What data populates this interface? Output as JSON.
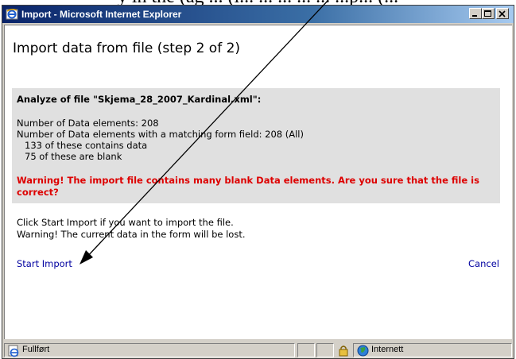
{
  "page_text_above": "y in the (ag ... (i... ... ... ... ... ...p... (...",
  "window": {
    "title": "Import - Microsoft Internet Explorer",
    "minimize_icon": "minimize-icon",
    "maximize_icon": "maximize-icon",
    "close_icon": "close-icon"
  },
  "dialog": {
    "heading": "Import data from file (step 2 of 2)",
    "analyze_title": "Analyze of file \"Skjema_28_2007_Kardinal.xml\":",
    "lines": [
      "Number of Data elements: 208",
      "Number of Data elements with a matching form field: 208 (All)",
      "133 of these contains data",
      "75 of these are blank"
    ],
    "warning": "Warning! The import file contains many blank Data elements. Are you sure that the file is correct?",
    "info_lines": [
      "Click Start Import if you want to import the file.",
      "Warning! The current data in the form will be lost."
    ],
    "start_import": "Start Import",
    "cancel": "Cancel"
  },
  "statusbar": {
    "status_text": "Fullført",
    "zone_text": "Internett"
  },
  "colors": {
    "warning": "#dd0000",
    "link": "#0000a0",
    "panel_bg": "#e0e0e0"
  }
}
